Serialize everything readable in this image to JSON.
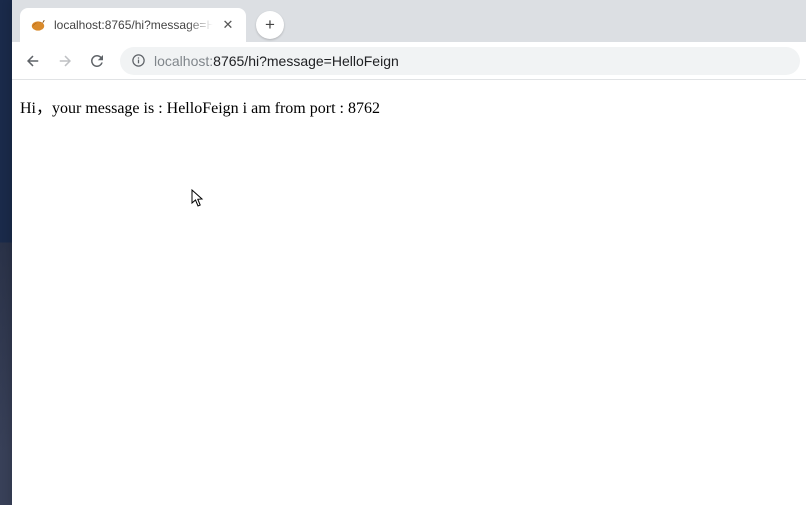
{
  "tab": {
    "title": "localhost:8765/hi?message=H",
    "close_icon_glyph": "✕"
  },
  "new_tab": {
    "glyph": "+"
  },
  "omnibox": {
    "host": "localhost:",
    "port_path": "8765/hi?message=HelloFeign"
  },
  "page": {
    "body_text": "Hi，your message is : HelloFeign i am from port : 8762"
  }
}
